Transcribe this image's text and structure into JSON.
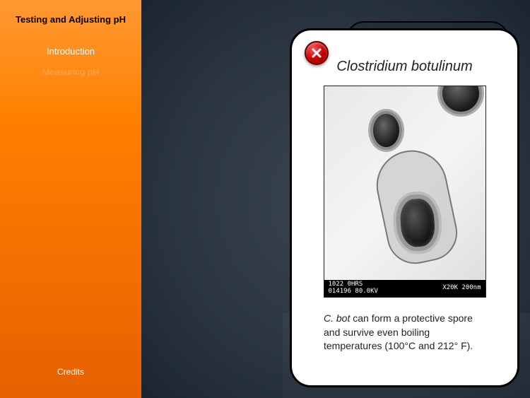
{
  "sidebar": {
    "title": "Testing and Adjusting pH",
    "items": [
      {
        "label": "Introduction",
        "active": true
      },
      {
        "label": "Measuring pH",
        "active": false
      }
    ],
    "credits": "Credits"
  },
  "modal": {
    "title": "Clostridium botulinum",
    "scale_info_left": "1022 0HRS\n014196 80.0KV",
    "scale_info_right": "X20K  200nm",
    "caption_species": "C. bot",
    "caption_text": " can form a protective spore and survive even boiling temperatures (100°C and 212° F)."
  }
}
